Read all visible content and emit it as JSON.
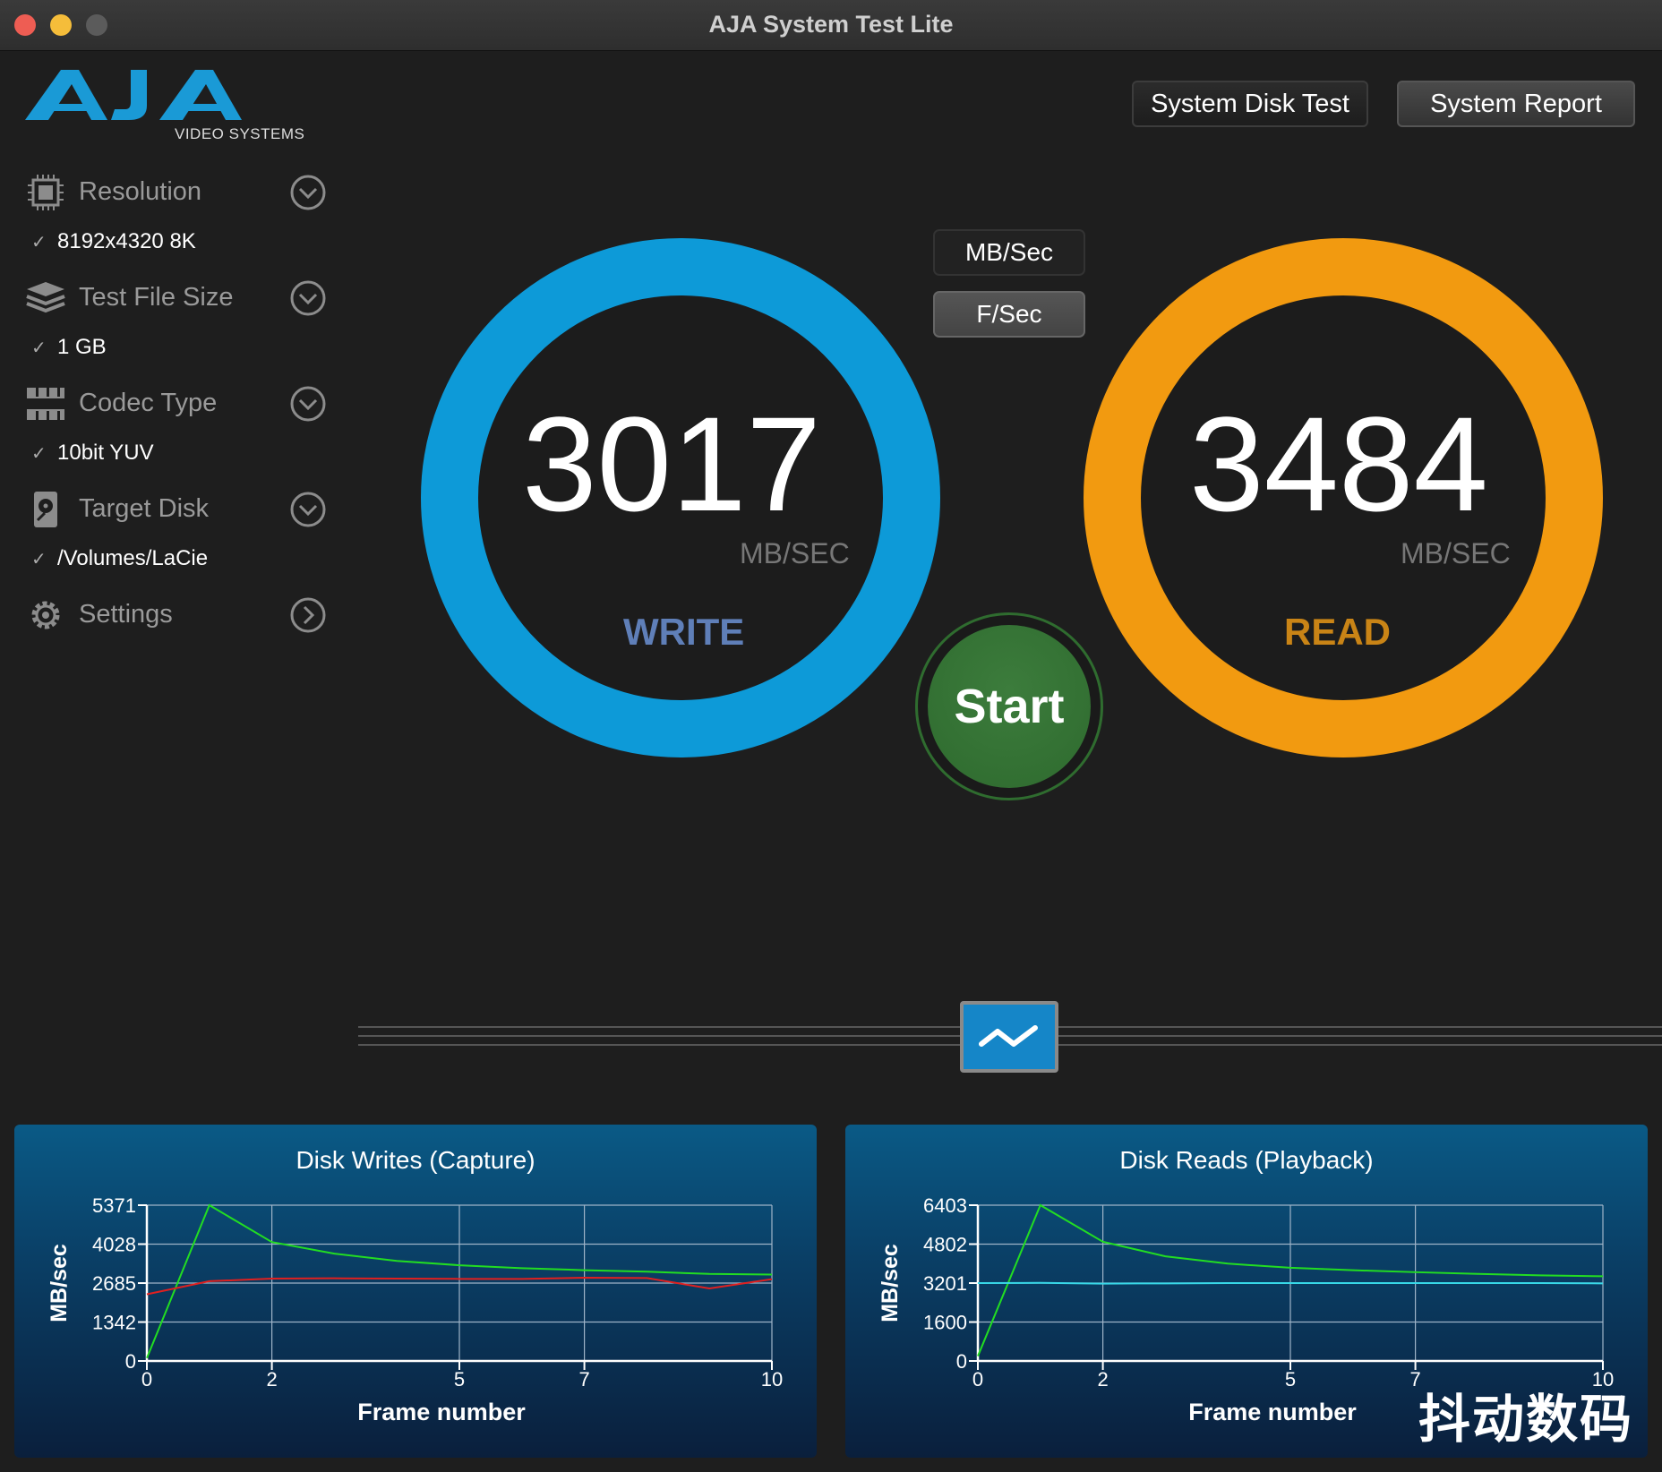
{
  "window": {
    "title": "AJA System Test Lite"
  },
  "logo": {
    "text": "AJA",
    "subtitle": "VIDEO SYSTEMS",
    "color": "#1a9ad6"
  },
  "toolbar": {
    "disk_test_label": "System Disk Test",
    "report_label": "System Report"
  },
  "sidebar": {
    "items": [
      {
        "label": "Resolution",
        "value": "8192x4320 8K",
        "icon": "chip-icon"
      },
      {
        "label": "Test File Size",
        "value": "1 GB",
        "icon": "layers-icon"
      },
      {
        "label": "Codec Type",
        "value": "10bit YUV",
        "icon": "film-icon"
      },
      {
        "label": "Target Disk",
        "value": "/Volumes/LaCie",
        "icon": "disk-icon"
      },
      {
        "label": "Settings",
        "icon": "gear-icon"
      }
    ],
    "check": "✓"
  },
  "units": {
    "mb_sec": "MB/Sec",
    "f_sec": "F/Sec"
  },
  "write": {
    "value": "3017",
    "unit": "MB/SEC",
    "label": "WRITE",
    "color": "#0d9ad8"
  },
  "read": {
    "value": "3484",
    "unit": "MB/SEC",
    "label": "READ",
    "color": "#f29a10"
  },
  "start_label": "Start",
  "watermark": "抖动数码",
  "chart_data": [
    {
      "type": "line",
      "title": "Disk Writes (Capture)",
      "xlabel": "Frame number",
      "ylabel": "MB/sec",
      "x_ticks": [
        "0",
        "2",
        "5",
        "7",
        "10"
      ],
      "y_ticks": [
        "5371",
        "4028",
        "2685",
        "1342",
        "0"
      ],
      "xlim": [
        0,
        10
      ],
      "ylim": [
        0,
        5371
      ],
      "grid": true,
      "series": [
        {
          "color": "#22dd22",
          "x": [
            0,
            1,
            2,
            3,
            4,
            5,
            6,
            7,
            8,
            9,
            10
          ],
          "values": [
            100,
            5371,
            4100,
            3700,
            3450,
            3300,
            3200,
            3130,
            3080,
            3000,
            2980
          ]
        },
        {
          "color": "#e02020",
          "x": [
            0,
            1,
            2,
            3,
            4,
            5,
            6,
            7,
            8,
            9,
            10
          ],
          "values": [
            2300,
            2750,
            2840,
            2850,
            2840,
            2830,
            2830,
            2870,
            2860,
            2500,
            2820
          ]
        }
      ]
    },
    {
      "type": "line",
      "title": "Disk Reads (Playback)",
      "xlabel": "Frame number",
      "ylabel": "MB/sec",
      "x_ticks": [
        "0",
        "2",
        "5",
        "7",
        "10"
      ],
      "y_ticks": [
        "6403",
        "4802",
        "3201",
        "1600",
        "0"
      ],
      "xlim": [
        0,
        10
      ],
      "ylim": [
        0,
        6403
      ],
      "grid": true,
      "series": [
        {
          "color": "#22dd22",
          "x": [
            0,
            1,
            2,
            3,
            4,
            5,
            6,
            7,
            8,
            9,
            10
          ],
          "values": [
            200,
            6403,
            4900,
            4300,
            4000,
            3830,
            3730,
            3650,
            3580,
            3520,
            3480
          ]
        },
        {
          "color": "#38d8e8",
          "x": [
            0,
            1,
            2,
            3,
            4,
            5,
            6,
            7,
            8,
            9,
            10
          ],
          "values": [
            3201,
            3210,
            3180,
            3190,
            3200,
            3200,
            3200,
            3200,
            3200,
            3200,
            3190
          ]
        }
      ]
    }
  ]
}
